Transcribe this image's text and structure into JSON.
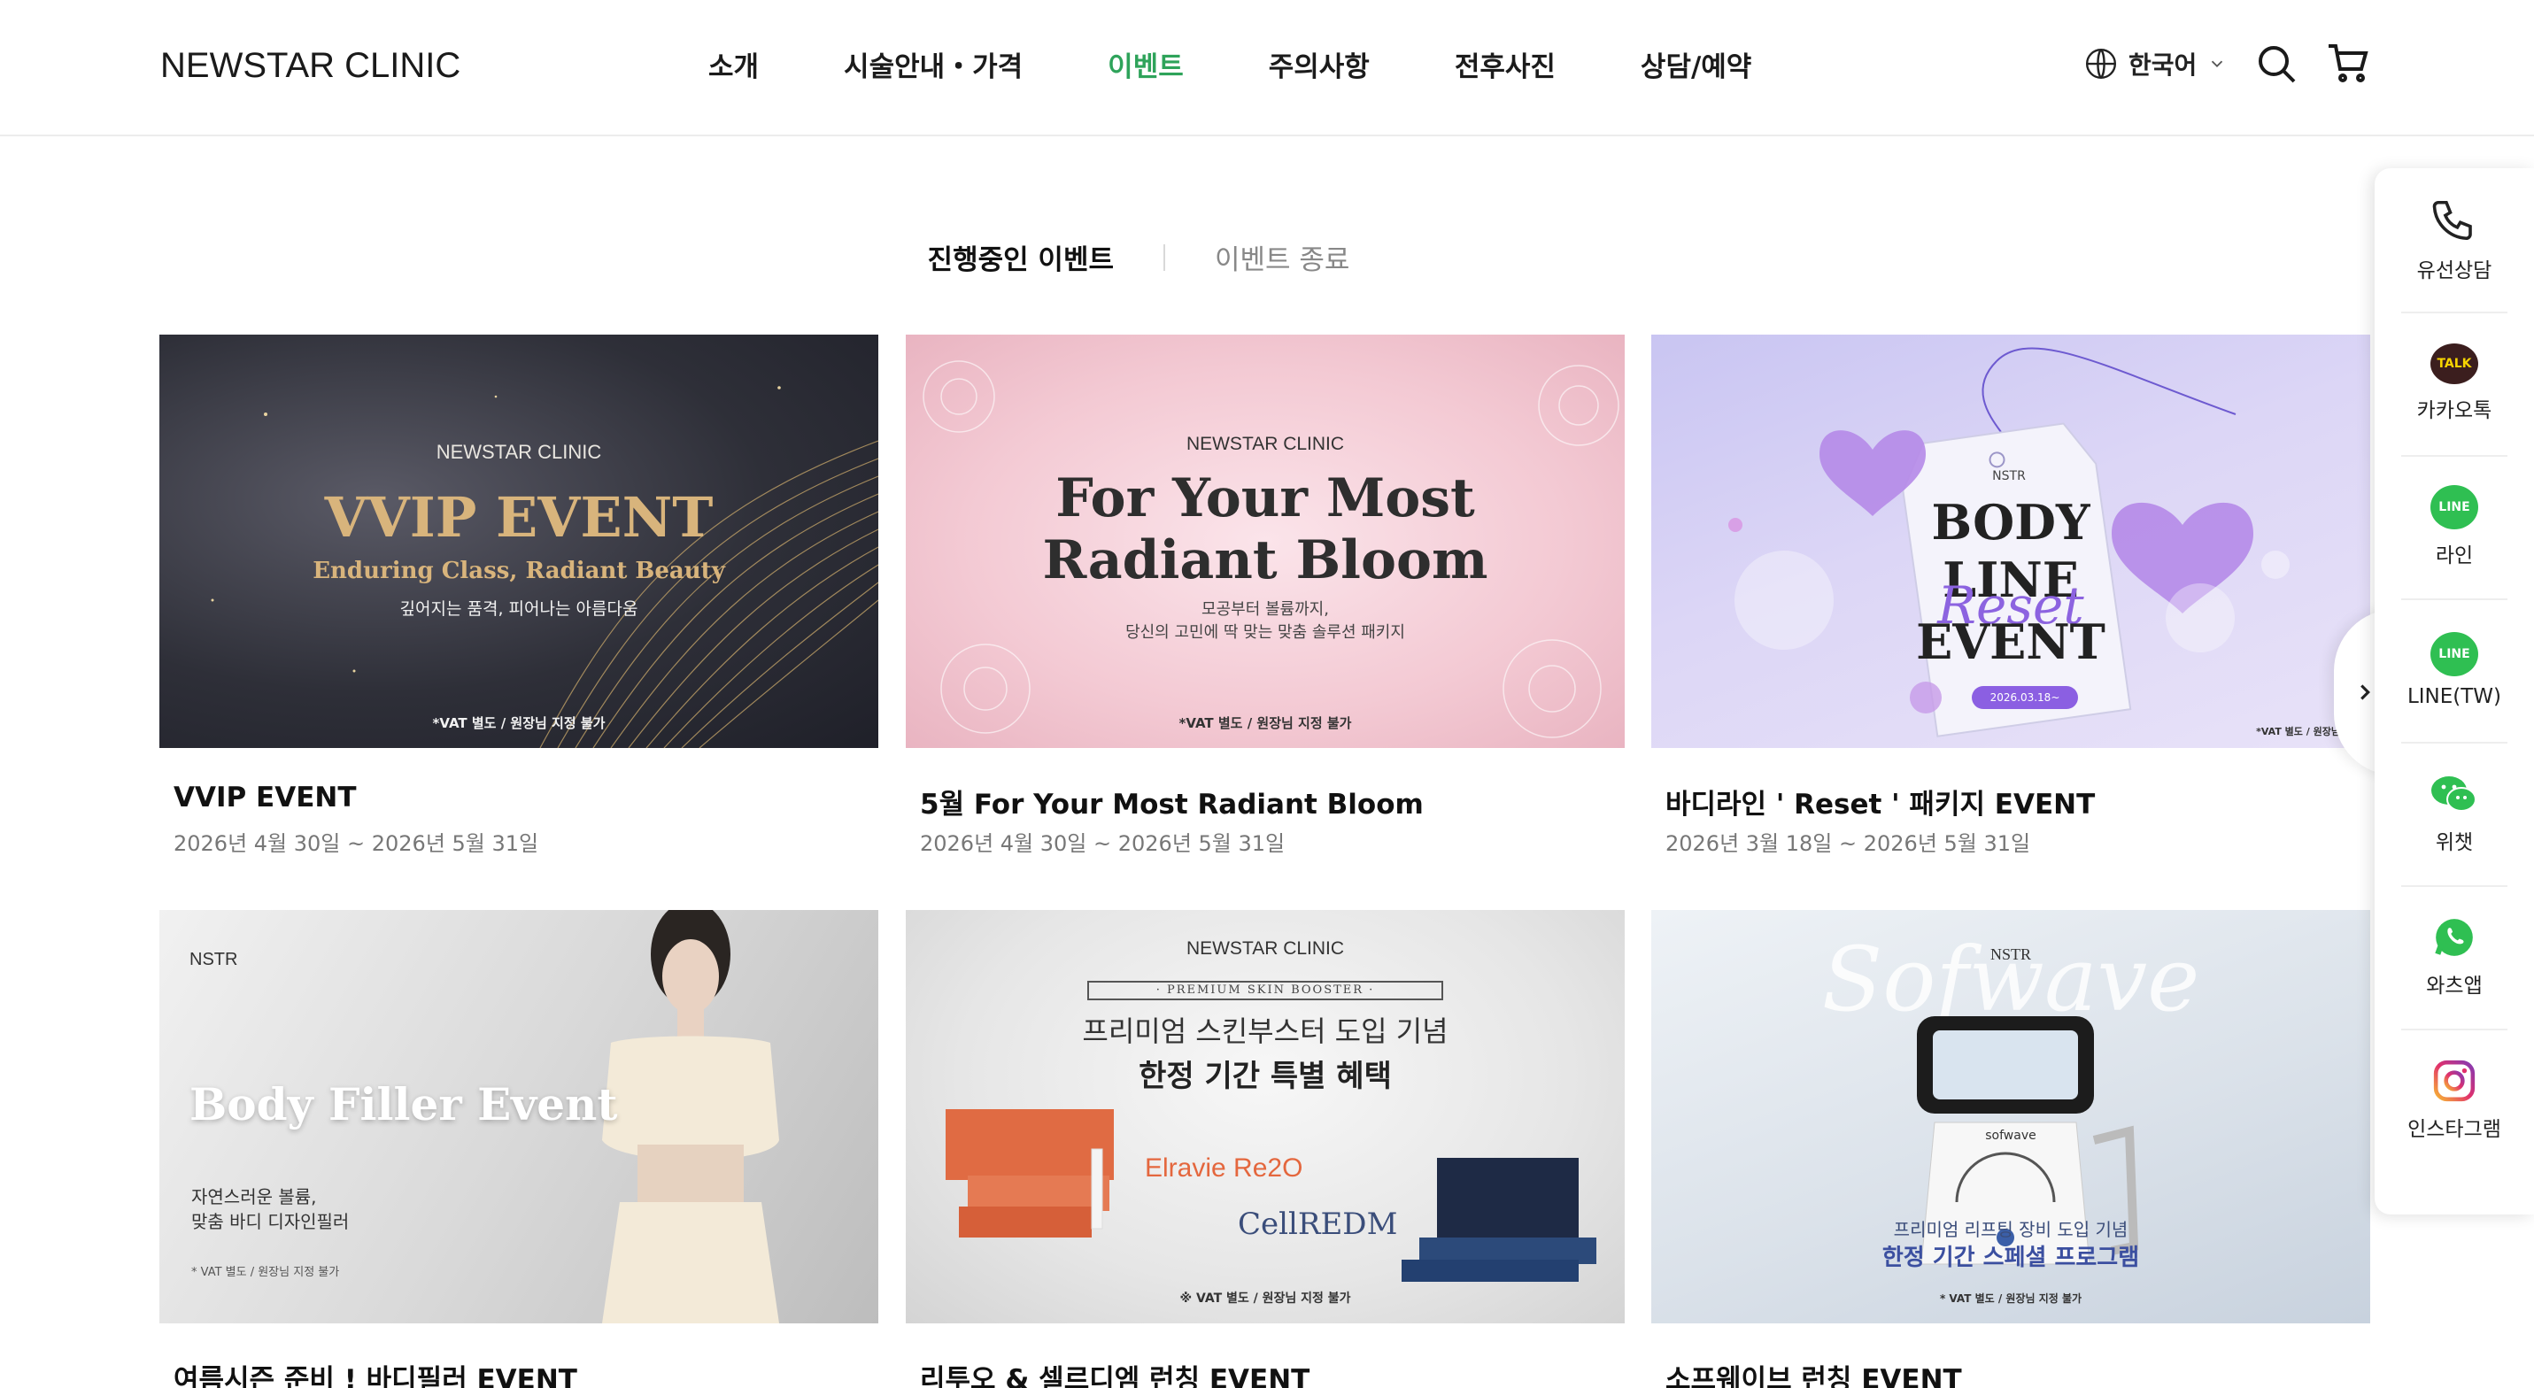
{
  "header": {
    "logo": "NEWSTAR CLINIC",
    "nav": [
      {
        "label": "소개"
      },
      {
        "label": "시술안내・가격"
      },
      {
        "label": "이벤트",
        "active": true
      },
      {
        "label": "주의사항"
      },
      {
        "label": "전후사진"
      },
      {
        "label": "상담/예약"
      }
    ],
    "language": "한국어",
    "accent_color": "#2ea35a"
  },
  "tabs": {
    "active": "진행중인 이벤트",
    "inactive": "이벤트 종료"
  },
  "events": [
    {
      "title": "VVIP EVENT",
      "date": "2026년 4월 30일 ~ 2026년 5월 31일",
      "image": {
        "brand": "NEWSTAR CLINIC",
        "headline": "VVIP EVENT",
        "sub": "Enduring Class, Radiant Beauty",
        "korean": "깊어지는 품격, 피어나는 아름다움",
        "note": "*VAT 별도 / 원장님 지정 불가"
      }
    },
    {
      "title": "5월 For Your Most Radiant Bloom",
      "date": "2026년 4월 30일 ~ 2026년 5월 31일",
      "image": {
        "brand": "NEWSTAR CLINIC",
        "headline1": "For Your Most",
        "headline2": "Radiant Bloom",
        "korean1": "모공부터 볼륨까지,",
        "korean2": "당신의 고민에 딱 맞는 맞춤 솔루션 패키지",
        "note": "*VAT 별도 / 원장님 지정 불가"
      }
    },
    {
      "title": "바디라인 ' Reset ' 패키지 EVENT",
      "date": "2026년 3월 18일 ~ 2026년 5월 31일",
      "image": {
        "brand": "NSTR",
        "line1": "BODY",
        "line2": "LINE",
        "script": "Reset",
        "line3": "EVENT",
        "badge": "2026.03.18~",
        "note": "*VAT 별도 / 원장님 지정"
      }
    },
    {
      "title": "여름시즌 준비 ! 바디필러 EVENT",
      "date": "",
      "image": {
        "brand": "NSTR",
        "headline": "Body Filler Event",
        "korean1": "자연스러운 볼륨,",
        "korean2": "맞춤 바디 디자인필러",
        "note": "* VAT 별도 / 원장님 지정 불가"
      }
    },
    {
      "title": "리투오 & 셀르디엠 런칭 EVENT",
      "date": "",
      "image": {
        "brand": "NEWSTAR CLINIC",
        "tag": "· PREMIUM SKIN BOOSTER ·",
        "korean1": "프리미엄 스킨부스터 도입 기념",
        "korean2": "한정 기간 특별 혜택",
        "product1": "Elravie Re2O",
        "product2": "CellREDM",
        "note": "※ VAT 별도 / 원장님 지정 불가"
      }
    },
    {
      "title": "소프웨이브 런칭 EVENT",
      "date": "",
      "image": {
        "brand": "NSTR",
        "script": "Sofwave",
        "device": "sofwave",
        "korean1": "프리미엄 리프팅 장비 도입 기념",
        "korean2": "한정 기간 스페셜 프로그램",
        "note": "* VAT 별도 / 원장님 지정 불가"
      }
    }
  ],
  "side_panel": [
    {
      "label": "유선상담",
      "icon": "phone-icon"
    },
    {
      "label": "카카오톡",
      "icon": "kakaotalk-icon",
      "badge": "TALK"
    },
    {
      "label": "라인",
      "icon": "line-icon",
      "badge": "LINE"
    },
    {
      "label": "LINE(TW)",
      "icon": "line-tw-icon",
      "badge": "LINE"
    },
    {
      "label": "위챗",
      "icon": "wechat-icon"
    },
    {
      "label": "와츠앱",
      "icon": "whatsapp-icon"
    },
    {
      "label": "인스타그램",
      "icon": "instagram-icon"
    }
  ]
}
